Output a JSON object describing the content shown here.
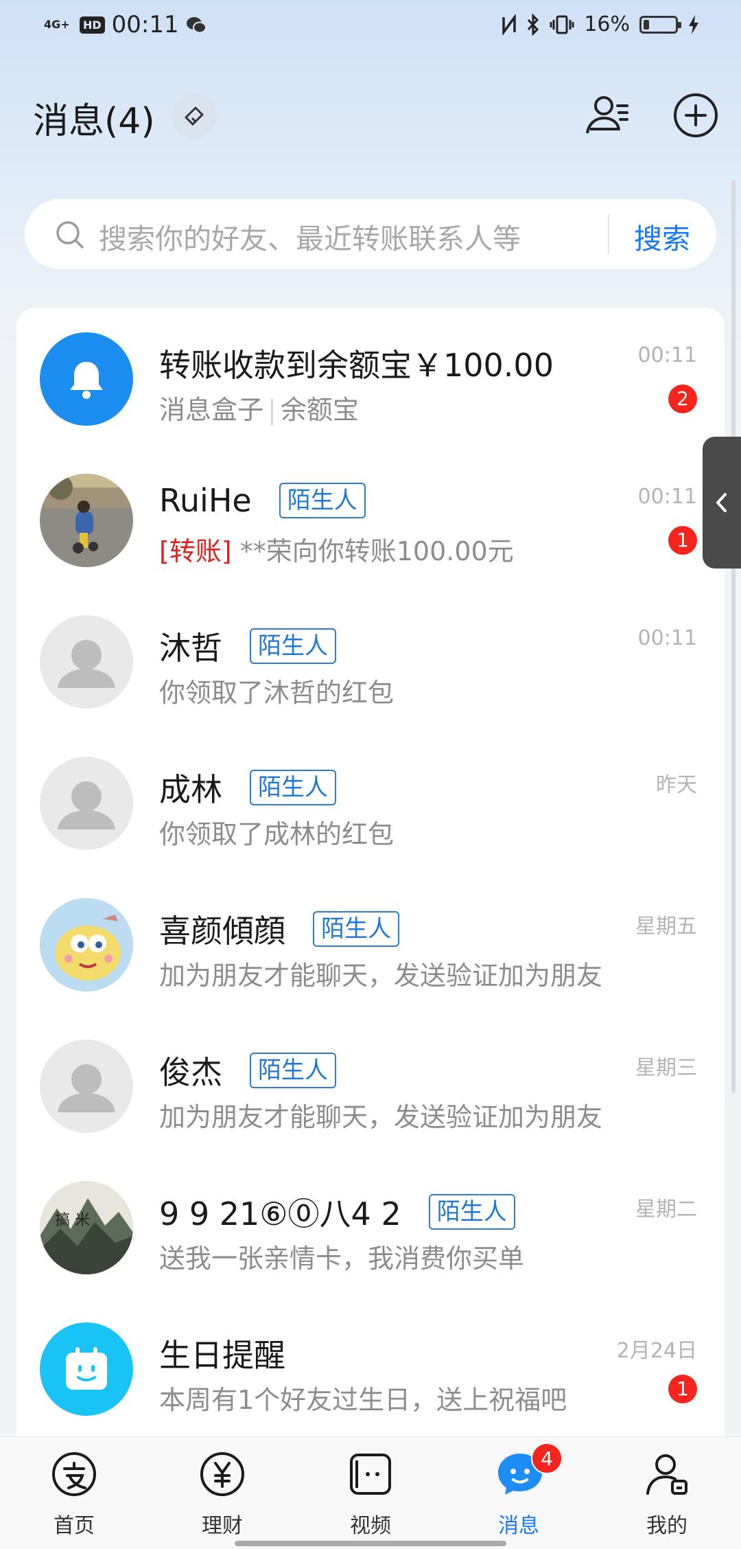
{
  "status_bar": {
    "network": "4G+",
    "hd": "HD",
    "time": "00:11",
    "battery": "16%",
    "battery_level": 0.16,
    "icons": [
      "nfc-icon",
      "bluetooth-icon",
      "vibrate-icon",
      "charging-icon"
    ]
  },
  "header": {
    "title": "消息(4)",
    "clean_icon": "broom-icon",
    "contacts_icon": "contacts-icon",
    "add_icon": "plus-circle-icon"
  },
  "search": {
    "placeholder": "搜索你的好友、最近转账联系人等",
    "button": "搜索"
  },
  "colors": {
    "accent": "#1677ff",
    "badge": "#f5241c",
    "tag": "#1f79d4"
  },
  "conversations": [
    {
      "name": "转账收款到余额宝￥100.00",
      "preview_a": "消息盒子",
      "sep": "|",
      "preview_b": "余额宝",
      "time": "00:11",
      "badge": "2",
      "avatar": "bell-icon"
    },
    {
      "name": "RuiHe",
      "tag": "陌生人",
      "preview_red": "[转账]",
      "preview": " **荣向你转账100.00元",
      "time": "00:11",
      "badge": "1",
      "avatar": "photo-child-bike"
    },
    {
      "name": "沐哲",
      "tag": "陌生人",
      "preview": "你领取了沐哲的红包",
      "time": "00:11",
      "avatar": "default-person-icon"
    },
    {
      "name": "成林",
      "tag": "陌生人",
      "preview": "你领取了成林的红包",
      "time": "昨天",
      "avatar": "default-person-icon"
    },
    {
      "name": "喜颜傾顔",
      "tag": "陌生人",
      "preview": "加为朋友才能聊天，发送验证加为朋友",
      "time": "星期五",
      "avatar": "cartoon-sponge-avatar"
    },
    {
      "name": "俊杰",
      "tag": "陌生人",
      "preview": "加为朋友才能聊天，发送验证加为朋友",
      "time": "星期三",
      "avatar": "default-person-icon"
    },
    {
      "name": "9 9 21⑥⓪八4 2",
      "tag": "陌生人",
      "preview": "送我一张亲情卡，我消费你买单",
      "time": "星期二",
      "avatar": "landscape-painting-avatar"
    },
    {
      "name": "生日提醒",
      "preview": "本周有1个好友过生日，送上祝福吧",
      "time": "2月24日",
      "badge": "1",
      "avatar": "calendar-icon"
    }
  ],
  "tabbar": [
    {
      "label": "首页",
      "icon": "alipay-home-icon"
    },
    {
      "label": "理财",
      "icon": "yuan-icon"
    },
    {
      "label": "视频",
      "icon": "video-icon"
    },
    {
      "label": "消息",
      "icon": "message-icon",
      "badge": "4",
      "active": true
    },
    {
      "label": "我的",
      "icon": "profile-icon"
    }
  ]
}
